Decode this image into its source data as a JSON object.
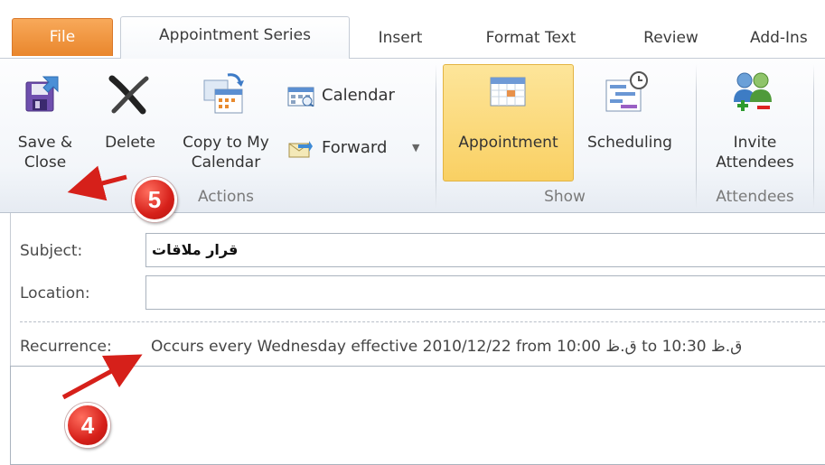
{
  "tabs": {
    "file": "File",
    "appointment_series": "Appointment Series",
    "insert": "Insert",
    "format_text": "Format Text",
    "review": "Review",
    "add_ins": "Add-Ins"
  },
  "ribbon": {
    "actions": {
      "save_close_line1": "Save &",
      "save_close_line2": "Close",
      "delete": "Delete",
      "copy_line1": "Copy to My",
      "copy_line2": "Calendar",
      "calendar": "Calendar",
      "forward": "Forward",
      "group_label": "Actions"
    },
    "show": {
      "appointment": "Appointment",
      "scheduling": "Scheduling",
      "group_label": "Show"
    },
    "attendees": {
      "invite_line1": "Invite",
      "invite_line2": "Attendees",
      "group_label": "Attendees"
    }
  },
  "form": {
    "subject_label": "Subject:",
    "subject_value": "قرار ملاقات",
    "location_label": "Location:",
    "location_value": "",
    "recurrence_label": "Recurrence:",
    "recurrence_text": "Occurs every Wednesday effective 2010/12/22 from 10:00 ق.ظ to 10:30 ق.ظ"
  },
  "annotations": {
    "step_5": "5",
    "step_4": "4"
  },
  "colors": {
    "file_tab": "#e9862c",
    "highlight": "#f9d063",
    "badge": "#d6201a",
    "arrow": "#d6201a"
  }
}
